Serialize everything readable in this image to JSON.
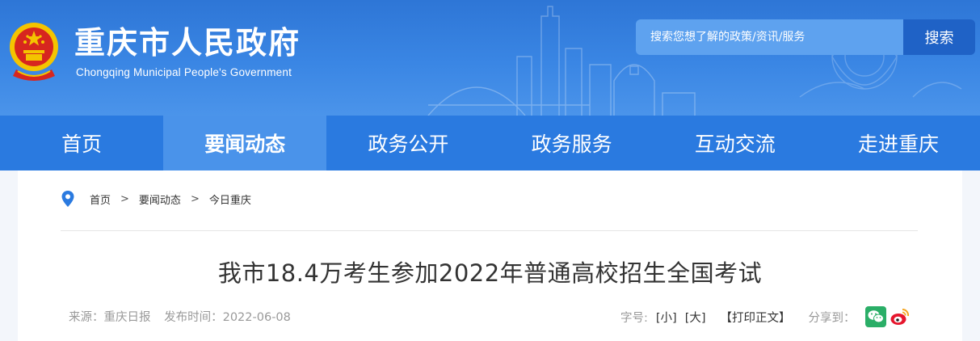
{
  "header": {
    "title": "重庆市人民政府",
    "subtitle": "Chongqing Municipal People's Government",
    "emblem_icon": "national-emblem-icon"
  },
  "search": {
    "placeholder": "搜索您想了解的政策/资讯/服务",
    "button_label": "搜索"
  },
  "nav": {
    "items": [
      {
        "label": "首页",
        "active": false
      },
      {
        "label": "要闻动态",
        "active": true
      },
      {
        "label": "政务公开",
        "active": false
      },
      {
        "label": "政务服务",
        "active": false
      },
      {
        "label": "互动交流",
        "active": false
      },
      {
        "label": "走进重庆",
        "active": false
      }
    ]
  },
  "breadcrumb": {
    "icon": "location-pin-icon",
    "items": [
      "首页",
      "要闻动态",
      "今日重庆"
    ],
    "separator": ">"
  },
  "article": {
    "title": "我市18.4万考生参加2022年普通高校招生全国考试",
    "source": "来源：重庆日报",
    "publish_time": "发布时间：2022-06-08"
  },
  "tools": {
    "font_size_label": "字号:",
    "small_label": "[小]",
    "large_label": "[大]",
    "print_label": "【打印正文】",
    "share_label": "分享到：",
    "share_icons": [
      "wechat-icon",
      "weibo-icon"
    ]
  },
  "colors": {
    "header_blue": "#3a86e4",
    "nav_blue": "#2a7ae0",
    "nav_active": "#4a93ea",
    "search_button": "#1f62c6",
    "wechat_green": "#2aae67",
    "weibo_red": "#e6162d"
  }
}
